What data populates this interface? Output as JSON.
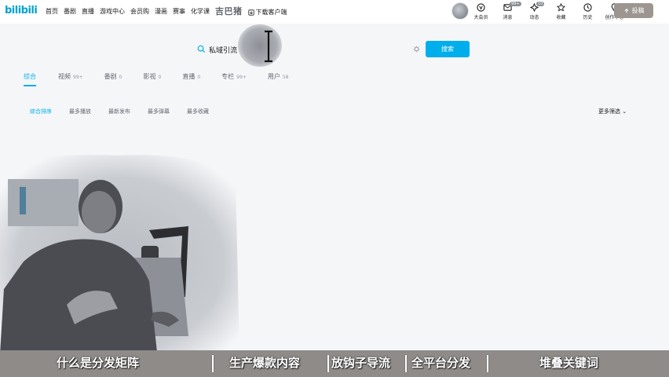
{
  "header": {
    "logo": "bilibili",
    "nav": [
      "首页",
      "番剧",
      "直播",
      "游戏中心",
      "会员购",
      "漫画",
      "赛事",
      "化学课",
      "吉巴猪",
      "下载客户端"
    ],
    "right_icons": [
      {
        "label": "大会员",
        "icon": "vip-icon",
        "badge": ""
      },
      {
        "label": "消息",
        "icon": "message-icon",
        "badge": "99+"
      },
      {
        "label": "动态",
        "icon": "dynamic-icon",
        "badge": "10"
      },
      {
        "label": "收藏",
        "icon": "favorite-icon",
        "badge": ""
      },
      {
        "label": "历史",
        "icon": "history-icon",
        "badge": ""
      },
      {
        "label": "创作中心",
        "icon": "creator-icon",
        "badge": ""
      }
    ],
    "upload_label": "投稿"
  },
  "search": {
    "value": "私域引流",
    "button_label": "搜索"
  },
  "tabs": [
    {
      "label": "综合",
      "count": ""
    },
    {
      "label": "视频",
      "count": "99+"
    },
    {
      "label": "番剧",
      "count": "0"
    },
    {
      "label": "影视",
      "count": "0"
    },
    {
      "label": "直播",
      "count": "0"
    },
    {
      "label": "专栏",
      "count": "99+"
    },
    {
      "label": "用户",
      "count": "58"
    }
  ],
  "sort_options": [
    "综合排序",
    "最多播放",
    "最新发布",
    "最多弹幕",
    "最多收藏"
  ],
  "more_filter": "更多筛选",
  "subtitles": [
    "什么是分发矩阵",
    "生产爆款内容",
    "放钩子导流",
    "全平台分发",
    "堆叠关键词"
  ],
  "colors": {
    "accent": "#00aeec",
    "upload_bg": "#9d9590",
    "subtitle_bar": "#8e8b88"
  }
}
